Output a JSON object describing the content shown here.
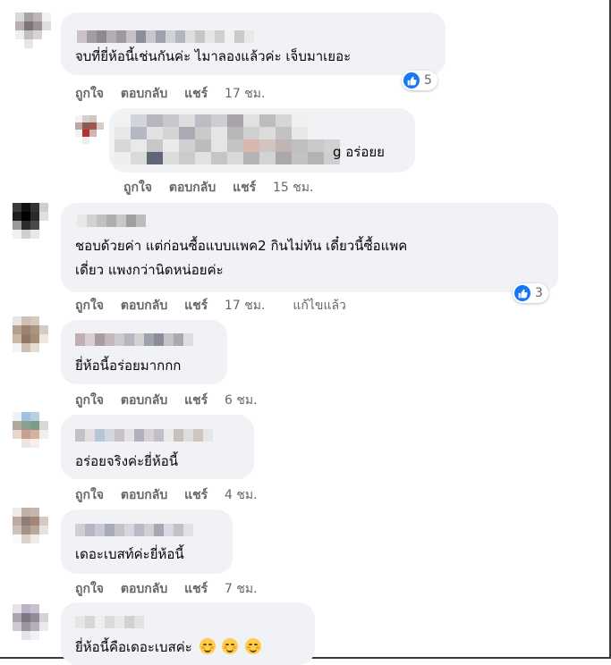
{
  "actions": {
    "like": "ถูกใจ",
    "reply": "ตอบกลับ",
    "share": "แชร์",
    "edited": "แก้ไขแล้ว"
  },
  "comments": [
    {
      "text": "จบที่ยี่ห้อนี้เช่นกันค่ะ ไมาลองแล้วค่ะ เจ็บมาเยอะ",
      "time": "17 ชม.",
      "reactions": "5"
    },
    {
      "text": "g อร่อยย",
      "time": "15 ชม."
    },
    {
      "text_line1": "ชอบด้วยค่า แต่ก่อนซื้อแบบแพค2 กินไม่ทัน เดี๋ยวนี้ซื้อแพค",
      "text_line2": "เดี่ยว แพงกว่านิดหน่อยค่ะ",
      "time": "17 ชม.",
      "reactions": "3"
    },
    {
      "text": "ยี่ห้อนี้อร่อยมากกก",
      "time": "6 ชม."
    },
    {
      "text": "อร่อยจริงค่ะยี่ห้อนี้",
      "time": "4 ชม."
    },
    {
      "text": "เดอะเบสท์ค่ะยี่ห้อนี้",
      "time": "7 ชม."
    },
    {
      "text": "ยี่ห้อนี้คือเดอะเบสค่ะ"
    }
  ],
  "colors": {
    "like_blue": "#1877f2",
    "bubble": "#f0f2f5",
    "meta_gray": "#65676b"
  },
  "icons": {
    "like": "thumbs-up-icon",
    "emoji": "smiling-face-icon"
  }
}
